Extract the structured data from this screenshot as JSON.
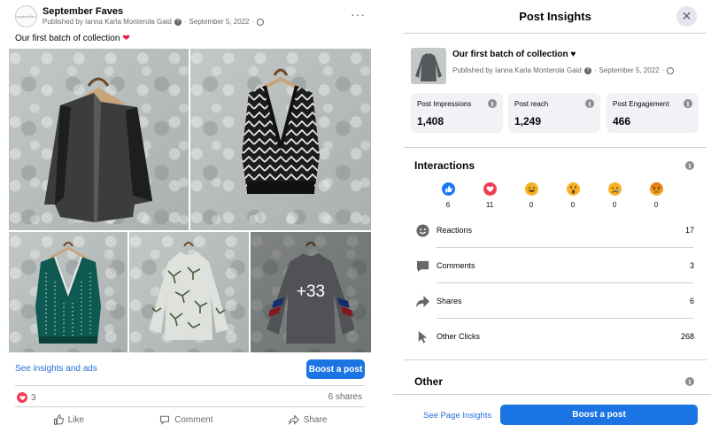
{
  "post": {
    "page_name": "September Faves",
    "avatar_text": "september",
    "meta_prefix": "Published by Ianna Karla Monterola Gaid",
    "meta_date": "September 5, 2022",
    "meta_sep": "·",
    "more_label": "···",
    "caption": "Our first batch of collection",
    "more_photos_label": "+33",
    "insights_link": "See insights and ads",
    "boost_label": "Boost a post",
    "reactions_count": "3",
    "shares_label": "6 shares",
    "actions": {
      "like": "Like",
      "comment": "Comment",
      "share": "Share"
    }
  },
  "panel": {
    "title": "Post Insights",
    "close_label": "✕",
    "post_title": "Our first batch of collection ♥",
    "post_meta": "Published by Ianna Karla Monterola Gaid",
    "post_date": "September 5, 2022",
    "stats": [
      {
        "label": "Post Impressions",
        "value": "1,408"
      },
      {
        "label": "Post reach",
        "value": "1,249"
      },
      {
        "label": "Post Engagement",
        "value": "466"
      }
    ],
    "interactions_title": "Interactions",
    "emoji_counts": [
      "6",
      "11",
      "0",
      "0",
      "0",
      "0"
    ],
    "metrics": [
      {
        "label": "Reactions",
        "value": "17"
      },
      {
        "label": "Comments",
        "value": "3"
      },
      {
        "label": "Shares",
        "value": "6"
      },
      {
        "label": "Other Clicks",
        "value": "268"
      }
    ],
    "other_title": "Other",
    "page_insights_link": "See Page Insights",
    "boost_label": "Boost a post"
  },
  "colors": {
    "accent": "#1b74e4",
    "link": "#216fdb",
    "like": "#1877f2",
    "love": "#f33e58",
    "haha": "#f7b125"
  }
}
